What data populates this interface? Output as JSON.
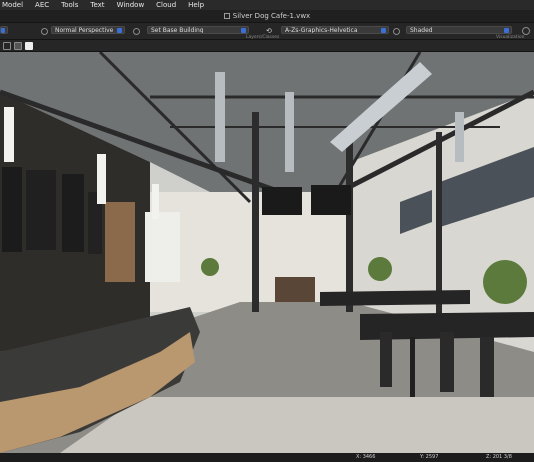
{
  "menubar": {
    "items": [
      "Model",
      "AEC",
      "Tools",
      "Text",
      "Window",
      "Cloud",
      "Help"
    ]
  },
  "window": {
    "title": "Silver Dog Cafe-1.vwx"
  },
  "toolbar": {
    "view_dropdown": "Normal Perspective",
    "layer_dropdown": "Set Base Building",
    "layer_sublabel": "Layers/Classes",
    "render_dropdown": "A-Zs-Graphics-Helvetica",
    "render_mode": "Shaded",
    "render_sublabel": "Visualization"
  },
  "status": {
    "x": "X: 3466",
    "y": "Y: 2597",
    "z": "Z: 201 3/8"
  },
  "colors": {
    "menubar_bg": "#2a2a2a",
    "toolbar_bg": "#262626",
    "accent": "#3b6fd6"
  }
}
